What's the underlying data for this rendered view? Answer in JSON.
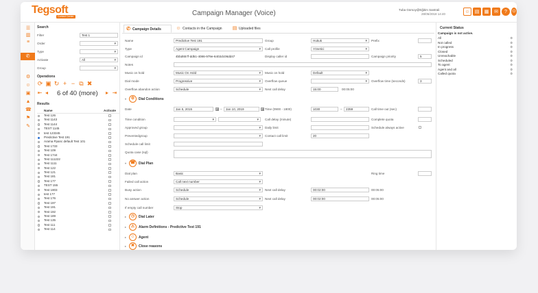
{
  "app": {
    "logo": "Tegsoft",
    "logo_tag": "Contact Center",
    "title": "Campaign Manager (Voice)",
    "user": "Tuba Gürsoy@Eğitim Santrali",
    "datetime": "28/05/2018 14:40"
  },
  "header_icons": [
    "user-icon",
    "document-icon",
    "grid-icon",
    "chat-icon",
    "help-icon",
    "power-icon"
  ],
  "search": {
    "title": "Search",
    "filter_label": "Filter",
    "filter_value": "Test 1",
    "order_label": "Order",
    "type_label": "Type",
    "activate_label": "Activate",
    "activate_value": "All",
    "group_label": "Group"
  },
  "operations": {
    "title": "Operations",
    "pager_text": "6 of 40 (more)"
  },
  "results": {
    "title": "Results",
    "col_name": "Name",
    "col_activate": "Activate",
    "rows": [
      {
        "name": "Test 126",
        "selected": false
      },
      {
        "name": "Test 1143",
        "selected": false
      },
      {
        "name": "Test 1144",
        "selected": false
      },
      {
        "name": "TEST 1145",
        "selected": false
      },
      {
        "name": "test 123345",
        "selected": false
      },
      {
        "name": "Predictive Test 191",
        "selected": true
      },
      {
        "name": "Arama Ppanc default Test 101",
        "selected": false
      },
      {
        "name": "Test 1733",
        "selected": false
      },
      {
        "name": "Test 109",
        "selected": false
      },
      {
        "name": "Test 1744",
        "selected": false
      },
      {
        "name": "Test 111222",
        "selected": false
      },
      {
        "name": "Test 1111",
        "selected": false
      },
      {
        "name": "Test 122",
        "selected": false
      },
      {
        "name": "Test 121",
        "selected": false
      },
      {
        "name": "Test 181",
        "selected": false
      },
      {
        "name": "Test 177",
        "selected": false
      },
      {
        "name": "TEST 155",
        "selected": false
      },
      {
        "name": "Test 1903",
        "selected": false
      },
      {
        "name": "test 177",
        "selected": false
      },
      {
        "name": "Test 176",
        "selected": false
      },
      {
        "name": "Test 197",
        "selected": false
      },
      {
        "name": "Test 191",
        "selected": false
      },
      {
        "name": "Test 192",
        "selected": false
      },
      {
        "name": "Test 189",
        "selected": false
      },
      {
        "name": "Test 135",
        "selected": false
      },
      {
        "name": "Test 111",
        "selected": false
      },
      {
        "name": "Test 114",
        "selected": false
      }
    ]
  },
  "tabs": [
    "Campaign Details",
    "Contacts in the Campaign",
    "Uploaded files"
  ],
  "form": {
    "name_label": "Name",
    "name_value": "Predictive Test 191",
    "group_label": "Group",
    "group_value": "Hukuk",
    "prefix_label": "Prefix",
    "type_label": "Type",
    "type_value": "Agent Campaign",
    "call_profile_label": "Call profile",
    "call_profile_value": "Yönetici",
    "campaign_id_label": "Campaign id",
    "campaign_id_value": "4bbd657f-dd51-4086-979e-6402dc06dd47",
    "display_caller_label": "Display caller id",
    "priority_label": "Campaign priority",
    "priority_value": "5",
    "notes_label": "Notes",
    "music_on_hold_label": "Music on hold",
    "music_on_hold_value": "Music On Hold",
    "music_on_hold2_label": "Music on hold",
    "music_on_hold2_value": "Default",
    "dial_mode_label": "Dial mode",
    "dial_mode_value": "Progressive",
    "overflow_queue_label": "Overflow queue",
    "overflow_time_label": "Overflow time (seconds)",
    "overflow_time_value": "3",
    "overflow_abandon_label": "Overflow abandon action",
    "overflow_abandon_value": "Schedule",
    "next_call_delay_label": "Next call delay",
    "next_call_delay_value": "15:00",
    "next_call_delay_value2": "00:05:00"
  },
  "dial_conditions": {
    "title": "Dial Conditions",
    "date_label": "Date",
    "date_from": "Jan 5, 2015",
    "date_to": "Jan 10, 2019",
    "time_label": "Time (0900 - 1800)",
    "time_from": "1030",
    "time_to": "2359",
    "time_out_label": "Call time out (sec)",
    "time_condition_label": "Time condition",
    "call_delay_label": "Call delay (minute)",
    "complete_quota_label": "Complete quota",
    "approved_group_label": "Approved group",
    "daily_limit_label": "Daily limit",
    "schedule_always_label": "Schedule always active",
    "prevented_group_label": "Preventedgroup",
    "contact_limit_label": "Contact call limit",
    "contact_limit_value": "20",
    "schedule_limit_label": "Schedule call limit",
    "quota_case_label": "Quota case (sql)"
  },
  "dial_plan": {
    "title": "Dial Plan",
    "dial_plan_label": "Dial plan",
    "dial_plan_value": "Basic",
    "ring_time_label": "Ring time",
    "failed_label": "Failed call action",
    "failed_value": "Call next number",
    "busy_label": "Busy action",
    "busy_value": "Schedule",
    "busy_delay_label": "Next call delay",
    "busy_delay_value": "00:02:00",
    "busy_delay_value2": "00:05:00",
    "noanswer_label": "No answer action",
    "noanswer_value": "Schedule",
    "noanswer_delay_label": "Next call delay",
    "noanswer_delay_value": "00:02:00",
    "noanswer_delay_value2": "00:05:00",
    "empty_label": "If empty call number",
    "empty_value": "Stop"
  },
  "collapsed_sections": [
    "Dial Later",
    "Alarm Definitions - Predictive Test 191",
    "Agent",
    "Close reasons"
  ],
  "current_status": {
    "title": "Current Status",
    "subtitle": "Campaign is not active.",
    "rows": [
      {
        "label": "All",
        "value": "0"
      },
      {
        "label": "Not called",
        "value": "0"
      },
      {
        "label": "In progress",
        "value": "0"
      },
      {
        "label": "Closed",
        "value": "0"
      },
      {
        "label": "Unreachable",
        "value": "0"
      },
      {
        "label": "Scheduled",
        "value": "0"
      },
      {
        "label": "To agent",
        "value": "0"
      },
      {
        "label": "Agent and all",
        "value": "0"
      },
      {
        "label": "Called quota",
        "value": "0"
      }
    ]
  },
  "colors": {
    "accent": "#f07a1a",
    "selected_radio": "#2a6fd1"
  }
}
